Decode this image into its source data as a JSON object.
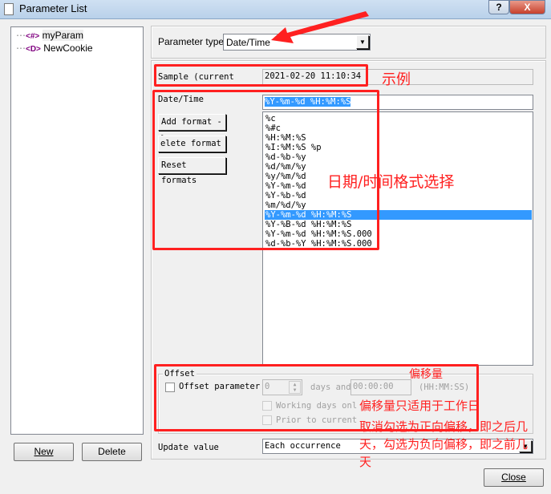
{
  "window": {
    "title": "Parameter List",
    "help_label": "?",
    "close_label": "X"
  },
  "tree": {
    "items": [
      {
        "icon": "<#>",
        "label": "myParam"
      },
      {
        "icon": "<D>",
        "label": "NewCookie"
      }
    ]
  },
  "left_buttons": {
    "new": "New",
    "delete": "Delete"
  },
  "param_type": {
    "label": "Parameter type:",
    "value": "Date/Time"
  },
  "sample": {
    "label": "Sample (current",
    "value": "2021-02-20 11:10:34"
  },
  "datetime": {
    "label": "Date/Time",
    "value": "%Y-%m-%d %H:%M:%S"
  },
  "format_buttons": {
    "add": "Add format ->",
    "delete": "elete format <",
    "reset": "Reset formats"
  },
  "formats": {
    "items": [
      "%c",
      "%#c",
      "%H:%M:%S",
      "%I:%M:%S %p",
      "%d-%b-%y",
      "%d/%m/%y",
      "%y/%m/%d",
      "%Y-%m-%d",
      "%Y-%b-%d",
      "%m/%d/%y",
      "%Y-%m-%d %H:%M:%S",
      "%Y-%B-%d %H:%M:%S",
      "%Y-%m-%d %H:%M:%S.000",
      "%d-%b-%Y %H:%M:%S.000"
    ],
    "selected": "%Y-%m-%d %H:%M:%S"
  },
  "offset": {
    "group": "Offset",
    "checkbox": "Offset parameter",
    "days_value": "0",
    "days_label": "days and",
    "time_value": "00:00:00",
    "time_hint": "(HH:MM:SS)",
    "working_days": "Working days onl",
    "prior": "Prior to current"
  },
  "update": {
    "label": "Update value",
    "value": "Each occurrence"
  },
  "close_button": "Close",
  "annotations": {
    "sample": "示例",
    "formats": "日期/时间格式选择",
    "offset": "偏移量",
    "working": "偏移量只适用于工作日",
    "prior_lines": [
      "取消勾选为正向偏移，即之后几",
      "天，勾选为负向偏移，即之前几",
      "天"
    ]
  },
  "colors": {
    "annotation": "#ff2020",
    "selection": "#3399ff"
  }
}
